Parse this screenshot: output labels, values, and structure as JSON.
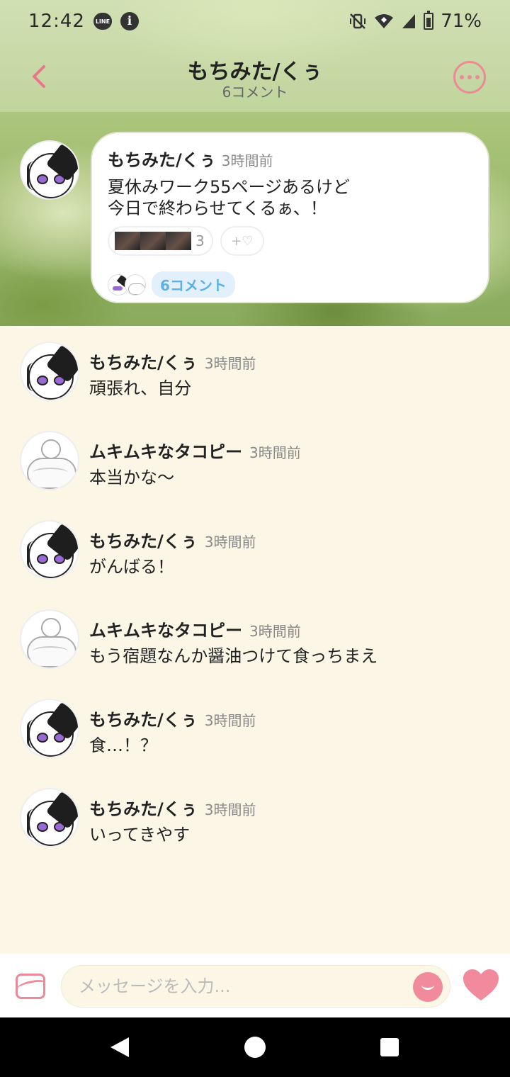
{
  "status_bar": {
    "time": "12:42",
    "line_badge": "LINE",
    "info_glyph": "i",
    "battery_percent": "71%",
    "icons": [
      "line-icon",
      "info-icon",
      "mute-vibrate-icon",
      "wifi-icon",
      "signal-icon",
      "battery-icon"
    ]
  },
  "header": {
    "back_glyph": "‹",
    "title": "もちみた/くぅ",
    "subtitle": "6コメント"
  },
  "post": {
    "author": "もちみた/くぅ",
    "time": "3時間前",
    "message": "夏休みワーク55ページあるけど\n今日で終わらせてくるぁ、！",
    "reaction_count": "3",
    "add_reaction_label": "+♡",
    "comment_tag": "6コメント"
  },
  "comments": [
    {
      "author": "もちみた/くぅ",
      "time": "3時間前",
      "text": "頑張れ、自分",
      "avatar": "anime-girl-avatar"
    },
    {
      "author": "ムキムキなタコピー",
      "time": "3時間前",
      "text": "本当かな〜",
      "avatar": "muscle-sketch-avatar"
    },
    {
      "author": "もちみた/くぅ",
      "time": "3時間前",
      "text": "がんばる！",
      "avatar": "anime-girl-avatar"
    },
    {
      "author": "ムキムキなタコピー",
      "time": "3時間前",
      "text": "もう宿題なんか醤油つけて食っちまえ",
      "avatar": "muscle-sketch-avatar"
    },
    {
      "author": "もちみた/くぅ",
      "time": "3時間前",
      "text": "食…！？",
      "avatar": "anime-girl-avatar"
    },
    {
      "author": "もちみた/くぅ",
      "time": "3時間前",
      "text": "いってきやす",
      "avatar": "anime-girl-avatar"
    }
  ],
  "composer": {
    "placeholder": "メッセージを入力...",
    "value": ""
  },
  "colors": {
    "accent_pink": "#ec8a98",
    "comment_tag_blue": "#5fb0e4",
    "background_cream": "#fcf6e6"
  }
}
